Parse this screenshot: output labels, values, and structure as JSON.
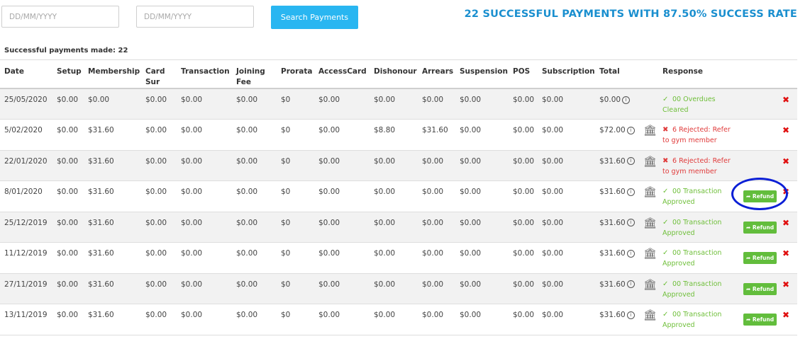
{
  "filters": {
    "from_placeholder": "DD/MM/YYYY",
    "to_placeholder": "DD/MM/YYYY",
    "search_label": "Search Payments"
  },
  "summary": {
    "title": "22 SUCCESSFUL PAYMENTS WITH 87.50% SUCCESS RATE",
    "count_line": "Successful payments made: 22"
  },
  "columns": [
    "Date",
    "Setup",
    "Membership",
    "Card Sur",
    "Transaction",
    "Joining Fee",
    "Prorata",
    "AccessCard",
    "Dishonour",
    "Arrears",
    "Suspension",
    "POS",
    "Subscription",
    "Total",
    "",
    "Response",
    "",
    ""
  ],
  "refund_label": "Refund",
  "colors": {
    "accent": "#29b6f1",
    "title": "#1a8fcf",
    "success": "#6fbf3a",
    "error": "#e03a3a",
    "refund": "#62bd3c",
    "annotation": "#0b1fd6"
  },
  "rows": [
    {
      "date": "25/05/2020",
      "setup": "$0.00",
      "membership": "$0.00",
      "card_sur": "$0.00",
      "transaction": "$0.00",
      "joining_fee": "$0.00",
      "prorata": "$0",
      "access_card": "$0.00",
      "dishonour": "$0.00",
      "arrears": "$0.00",
      "suspension": "$0.00",
      "pos": "$0.00",
      "subscription": "$0.00",
      "total": "$0.00",
      "status": "ok",
      "response": "00 Overdues Cleared",
      "bank": false,
      "refund": false
    },
    {
      "date": "5/02/2020",
      "setup": "$0.00",
      "membership": "$31.60",
      "card_sur": "$0.00",
      "transaction": "$0.00",
      "joining_fee": "$0.00",
      "prorata": "$0",
      "access_card": "$0.00",
      "dishonour": "$8.80",
      "arrears": "$31.60",
      "suspension": "$0.00",
      "pos": "$0.00",
      "subscription": "$0.00",
      "total": "$72.00",
      "status": "bad",
      "response": "6 Rejected: Refer to gym member",
      "bank": true,
      "refund": false
    },
    {
      "date": "22/01/2020",
      "setup": "$0.00",
      "membership": "$31.60",
      "card_sur": "$0.00",
      "transaction": "$0.00",
      "joining_fee": "$0.00",
      "prorata": "$0",
      "access_card": "$0.00",
      "dishonour": "$0.00",
      "arrears": "$0.00",
      "suspension": "$0.00",
      "pos": "$0.00",
      "subscription": "$0.00",
      "total": "$31.60",
      "status": "bad",
      "response": "6 Rejected: Refer to gym member",
      "bank": true,
      "refund": false
    },
    {
      "date": "8/01/2020",
      "setup": "$0.00",
      "membership": "$31.60",
      "card_sur": "$0.00",
      "transaction": "$0.00",
      "joining_fee": "$0.00",
      "prorata": "$0",
      "access_card": "$0.00",
      "dishonour": "$0.00",
      "arrears": "$0.00",
      "suspension": "$0.00",
      "pos": "$0.00",
      "subscription": "$0.00",
      "total": "$31.60",
      "status": "ok",
      "response": "00 Transaction Approved",
      "bank": true,
      "refund": true
    },
    {
      "date": "25/12/2019",
      "setup": "$0.00",
      "membership": "$31.60",
      "card_sur": "$0.00",
      "transaction": "$0.00",
      "joining_fee": "$0.00",
      "prorata": "$0",
      "access_card": "$0.00",
      "dishonour": "$0.00",
      "arrears": "$0.00",
      "suspension": "$0.00",
      "pos": "$0.00",
      "subscription": "$0.00",
      "total": "$31.60",
      "status": "ok",
      "response": "00 Transaction Approved",
      "bank": true,
      "refund": true
    },
    {
      "date": "11/12/2019",
      "setup": "$0.00",
      "membership": "$31.60",
      "card_sur": "$0.00",
      "transaction": "$0.00",
      "joining_fee": "$0.00",
      "prorata": "$0",
      "access_card": "$0.00",
      "dishonour": "$0.00",
      "arrears": "$0.00",
      "suspension": "$0.00",
      "pos": "$0.00",
      "subscription": "$0.00",
      "total": "$31.60",
      "status": "ok",
      "response": "00 Transaction Approved",
      "bank": true,
      "refund": true
    },
    {
      "date": "27/11/2019",
      "setup": "$0.00",
      "membership": "$31.60",
      "card_sur": "$0.00",
      "transaction": "$0.00",
      "joining_fee": "$0.00",
      "prorata": "$0",
      "access_card": "$0.00",
      "dishonour": "$0.00",
      "arrears": "$0.00",
      "suspension": "$0.00",
      "pos": "$0.00",
      "subscription": "$0.00",
      "total": "$31.60",
      "status": "ok",
      "response": "00 Transaction Approved",
      "bank": true,
      "refund": true
    },
    {
      "date": "13/11/2019",
      "setup": "$0.00",
      "membership": "$31.60",
      "card_sur": "$0.00",
      "transaction": "$0.00",
      "joining_fee": "$0.00",
      "prorata": "$0",
      "access_card": "$0.00",
      "dishonour": "$0.00",
      "arrears": "$0.00",
      "suspension": "$0.00",
      "pos": "$0.00",
      "subscription": "$0.00",
      "total": "$31.60",
      "status": "ok",
      "response": "00 Transaction Approved",
      "bank": true,
      "refund": true
    }
  ]
}
